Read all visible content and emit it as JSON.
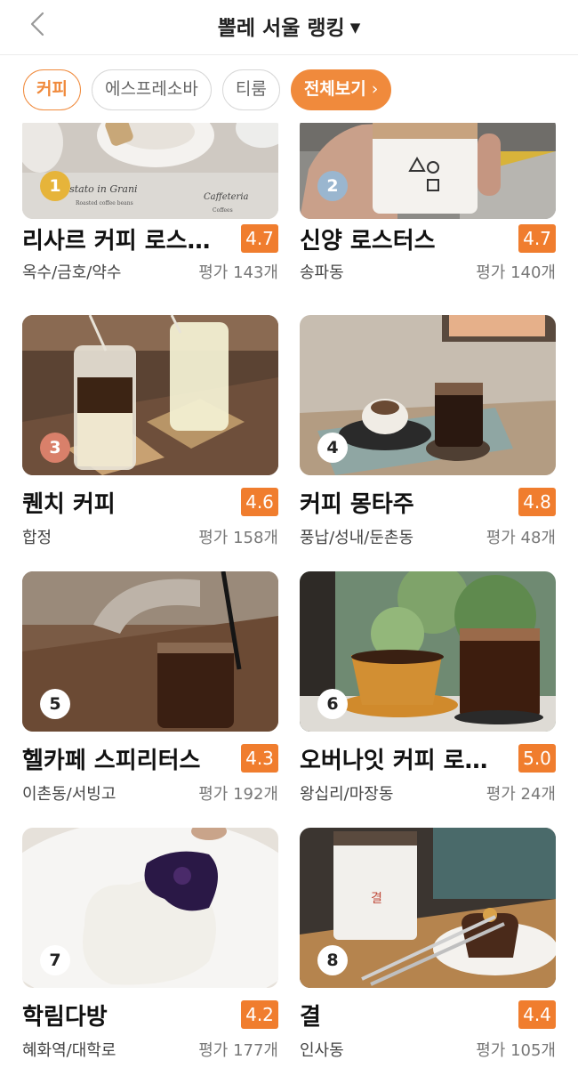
{
  "header": {
    "title": "뽈레 서울 랭킹",
    "caret": "▼"
  },
  "chips": [
    {
      "label": "커피"
    },
    {
      "label": "에스프레소바"
    },
    {
      "label": "티룸"
    },
    {
      "label": "전체보기",
      "arrow": "›"
    }
  ],
  "places": [
    {
      "rank": "1",
      "name": "리사르 커피 로스…",
      "rating": "4.7",
      "area": "옥수/금호/약수",
      "reviews": "평가 143개",
      "photo_text_1": "Tostato in Grani",
      "photo_text_2": "Roasted coffee beans",
      "photo_text_3": "Caffeteria",
      "photo_text_4": "Coffees"
    },
    {
      "rank": "2",
      "name": "신양 로스터스",
      "rating": "4.7",
      "area": "송파동",
      "reviews": "평가 140개"
    },
    {
      "rank": "3",
      "name": "퀜치 커피",
      "rating": "4.6",
      "area": "합정",
      "reviews": "평가 158개"
    },
    {
      "rank": "4",
      "name": "커피 몽타주",
      "rating": "4.8",
      "area": "풍납/성내/둔촌동",
      "reviews": "평가 48개"
    },
    {
      "rank": "5",
      "name": "헬카페 스피리터스",
      "rating": "4.3",
      "area": "이촌동/서빙고",
      "reviews": "평가 192개"
    },
    {
      "rank": "6",
      "name": "오버나잇 커피 로…",
      "rating": "5.0",
      "area": "왕십리/마장동",
      "reviews": "평가 24개"
    },
    {
      "rank": "7",
      "name": "학림다방",
      "rating": "4.2",
      "area": "혜화역/대학로",
      "reviews": "평가 177개"
    },
    {
      "rank": "8",
      "name": "결",
      "rating": "4.4",
      "area": "인사동",
      "reviews": "평가 105개",
      "cup_text": "결"
    }
  ],
  "colors": {
    "accent": "#f07d2e",
    "gold": "#e6b43a",
    "silver": "#9ab6cf",
    "bronze": "#d9806a"
  }
}
